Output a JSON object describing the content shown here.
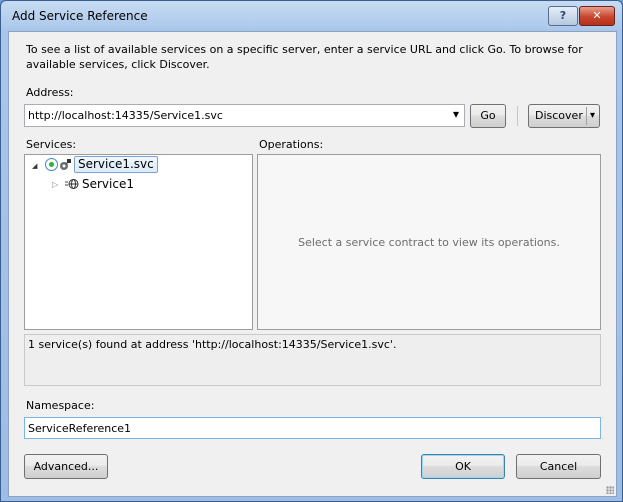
{
  "window": {
    "title": "Add Service Reference",
    "help_icon": "question-icon",
    "close_icon": "close-icon",
    "help_glyph": "?",
    "close_glyph": "✕"
  },
  "intro_text": "To see a list of available services on a specific server, enter a service URL and click Go. To browse for available services, click Discover.",
  "address": {
    "label": "Address:",
    "value": "http://localhost:14335/Service1.svc",
    "dropdown_glyph": "▾",
    "go_label": "Go",
    "discover_label": "Discover",
    "discover_dropdown_glyph": "▾"
  },
  "services": {
    "label": "Services:",
    "tree": [
      {
        "label": "Service1.svc",
        "expanded": true,
        "selected": true,
        "toggle_glyph": "◢",
        "icon": "service-reference-icon"
      },
      {
        "label": "Service1",
        "expanded": false,
        "selected": false,
        "toggle_glyph": "▷",
        "icon": "globe-icon"
      }
    ]
  },
  "operations": {
    "label": "Operations:",
    "placeholder": "Select a service contract to view its operations."
  },
  "status_message": "1 service(s) found at address 'http://localhost:14335/Service1.svc'.",
  "namespace": {
    "label": "Namespace:",
    "value": "ServiceReference1"
  },
  "buttons": {
    "advanced": "Advanced...",
    "ok": "OK",
    "cancel": "Cancel"
  }
}
